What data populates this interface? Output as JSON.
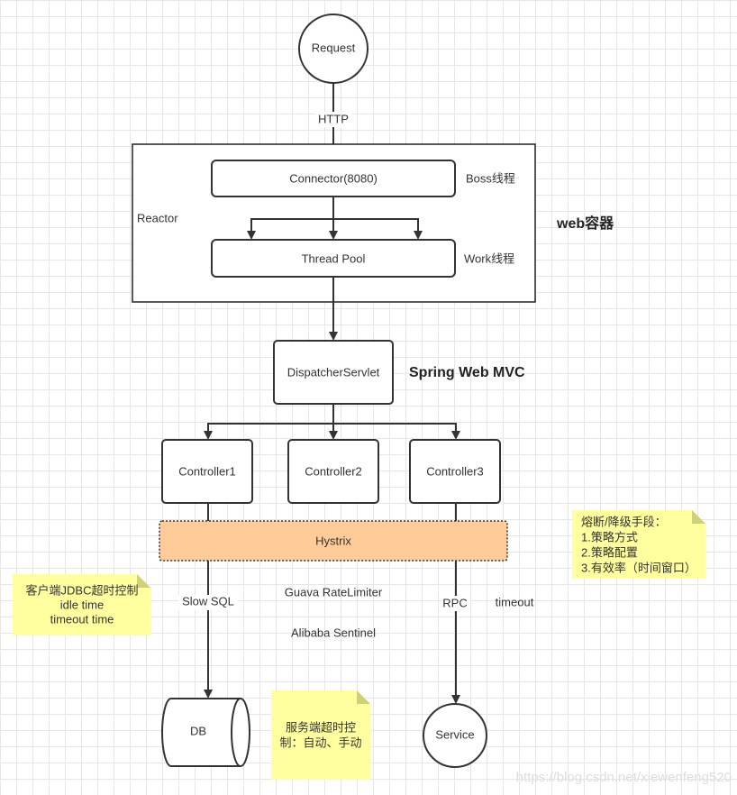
{
  "nodes": {
    "request": "Request",
    "http": "HTTP",
    "connector": "Connector(8080)",
    "boss": "Boss线程",
    "reactor": "Reactor",
    "thread_pool": "Thread Pool",
    "work": "Work线程",
    "web_container": "web容器",
    "dispatcher": "DispatcherServlet",
    "spring_mvc": "Spring Web MVC",
    "controllers": [
      "Controller1",
      "Controller2",
      "Controller3"
    ],
    "hystrix": "Hystrix",
    "slow_sql": "Slow SQL",
    "guava": "Guava RateLimiter",
    "sentinel": "Alibaba Sentinel",
    "rpc": "RPC",
    "timeout": "timeout",
    "db": "DB",
    "service": "Service"
  },
  "notes": {
    "circuit": [
      "熔断/降级手段：",
      "1.策略方式",
      "2.策略配置",
      "3.有效率（时间窗口）"
    ],
    "client": [
      "客户端JDBC超时控制",
      "idle time",
      "timeout time"
    ],
    "server": [
      "服务端超时控",
      "制：自动、手动"
    ]
  },
  "watermark": "https://blog.csdn.net/xiewenfeng520",
  "colors": {
    "hystrix_fill": "#ffcc99",
    "note_fill": "#ffff9f"
  }
}
